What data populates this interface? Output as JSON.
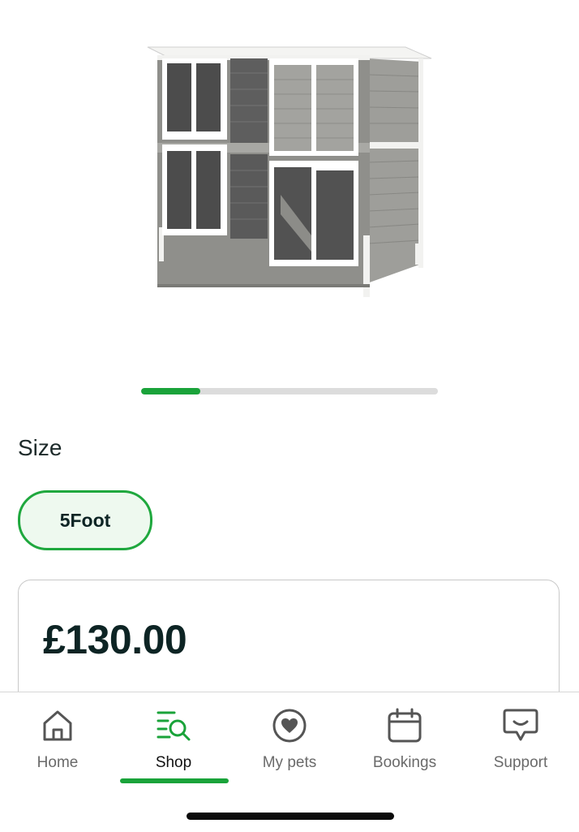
{
  "product": {
    "image_icon": "rabbit-hutch-image",
    "carousel": {
      "current": 1,
      "total": 5,
      "progress": 0.2
    }
  },
  "size": {
    "label": "Size",
    "selected": "5Foot"
  },
  "price": "£130.00",
  "nav": {
    "items": [
      {
        "label": "Home",
        "icon": "home-icon"
      },
      {
        "label": "Shop",
        "icon": "shop-search-icon"
      },
      {
        "label": "My pets",
        "icon": "heart-icon"
      },
      {
        "label": "Bookings",
        "icon": "calendar-icon"
      },
      {
        "label": "Support",
        "icon": "chat-icon"
      }
    ],
    "active": "Shop"
  },
  "colors": {
    "accent": "#1aa33a",
    "chip_bg": "#eef9ef",
    "text_dark": "#0d2424"
  }
}
